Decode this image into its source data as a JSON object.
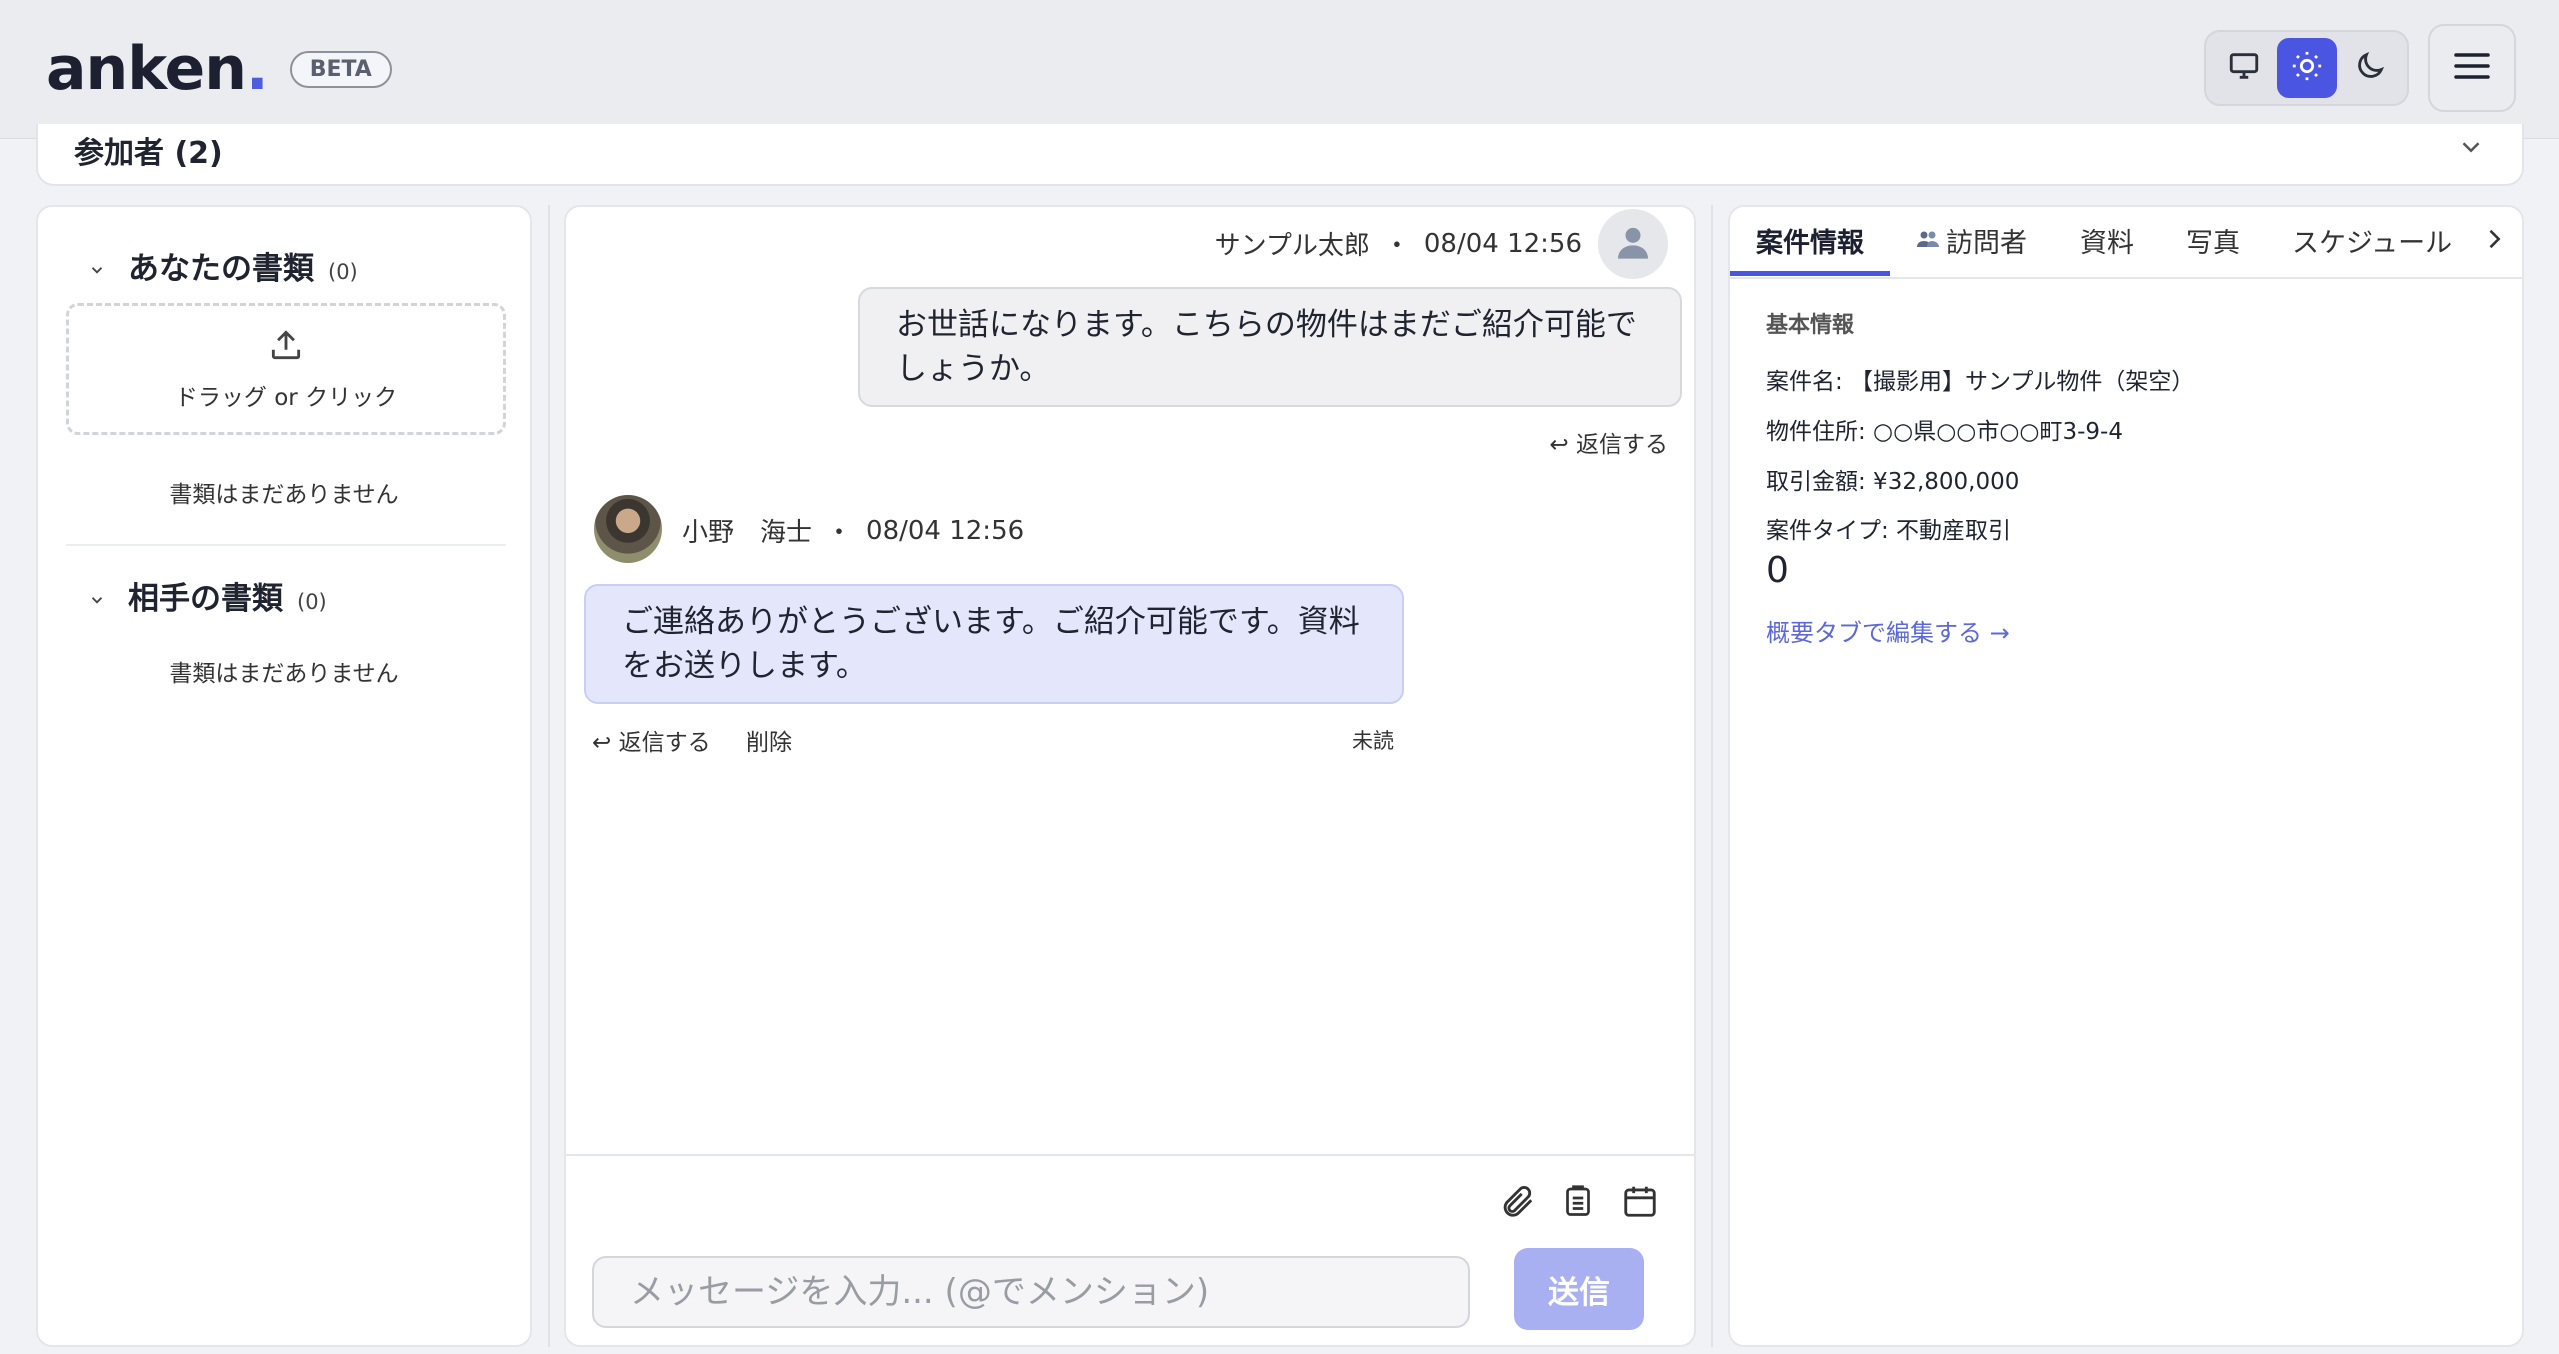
{
  "header": {
    "logo_text": "anken",
    "logo_dot": ".",
    "beta": "BETA",
    "theme": [
      "monitor-icon",
      "sun-icon",
      "moon-icon"
    ],
    "accent": "#4a56e2"
  },
  "participants": {
    "label": "参加者 (2)"
  },
  "documents": {
    "mine": {
      "title": "あなたの書類",
      "count": "(0)",
      "empty": "書類はまだありません"
    },
    "dropzone_label": "ドラッグ or クリック",
    "theirs": {
      "title": "相手の書類",
      "count": "(0)",
      "empty": "書類はまだありません"
    }
  },
  "chat": {
    "messages": [
      {
        "sender": "サンプル太郎",
        "sep": "・",
        "time": "08/04 12:56",
        "text": "お世話になります。こちらの物件はまだご紹介可能でしょうか。",
        "reply": "↩ 返信する"
      },
      {
        "sender": "小野　海士",
        "sep": "・",
        "time": "08/04 12:56",
        "text": "ご連絡ありがとうございます。ご紹介可能です。資料をお送りします。",
        "reply": "↩ 返信する",
        "delete": "削除",
        "status": "未読"
      }
    ],
    "input_placeholder": "メッセージを入力... (@でメンション)",
    "send_label": "送信"
  },
  "info_panel": {
    "tabs": [
      "案件情報",
      "訪問者",
      "資料",
      "写真",
      "スケジュール"
    ],
    "section_title": "基本情報",
    "rows": [
      "案件名: 【撮影用】サンプル物件（架空）",
      "物件住所: ○○県○○市○○町3-9-4",
      "取引金額: ¥32,800,000",
      "案件タイプ: 不動産取引"
    ],
    "zero": "0",
    "edit_link": "概要タブで編集する →"
  }
}
